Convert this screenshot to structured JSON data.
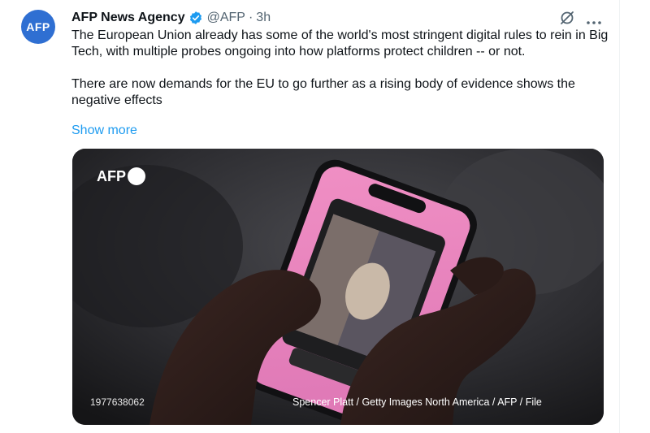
{
  "author": {
    "avatar_text": "AFP",
    "name": "AFP News Agency",
    "handle": "@AFP",
    "separator": "·",
    "time": "3h",
    "verified_icon": "verified-badge-icon"
  },
  "actions": {
    "grok_icon": "grok-icon",
    "more_icon": "more-icon"
  },
  "tweet": {
    "paragraph_1": "The European Union already has some of the world's most stringent digital rules to rein in Big Tech, with multiple probes ongoing into how platforms protect children -- or not.",
    "paragraph_2": "There are now demands for the EU to go further as a rising body of evidence shows the negative effects",
    "show_more": "Show more"
  },
  "media": {
    "watermark": "AFP",
    "photo_id": "1977638062",
    "credit": "Spencer Platt / Getty Images North America / AFP / File"
  },
  "colors": {
    "accent": "#1d9bf0",
    "avatar": "#2f6fd2",
    "secondary_text": "#536471"
  }
}
